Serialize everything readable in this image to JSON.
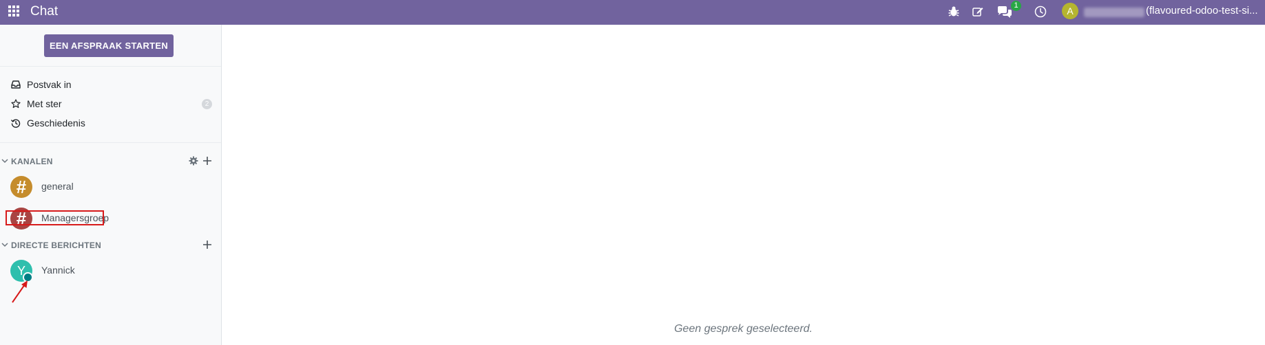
{
  "topbar": {
    "app_title": "Chat",
    "messages_badge": "1",
    "user_avatar_letter": "A",
    "company": "(flavoured-odoo-test-si...",
    "icons": [
      "apps-icon",
      "debug-bug-icon",
      "edit-icon",
      "chat-bubbles-icon",
      "clock-icon"
    ]
  },
  "sidebar": {
    "start_meeting": "EEN AFSPRAAK STARTEN",
    "mailboxes": [
      {
        "label": "Postvak in",
        "icon": "inbox-icon"
      },
      {
        "label": "Met ster",
        "icon": "star-icon",
        "counter": "2"
      },
      {
        "label": "Geschiedenis",
        "icon": "history-icon"
      }
    ],
    "channels_header": "KANALEN",
    "channels": [
      {
        "name": "general",
        "avatar": "#",
        "color": "#c58c2c"
      },
      {
        "name": "Managersgroep",
        "avatar": "#",
        "color": "#a94442"
      }
    ],
    "dm_header": "DIRECTE BERICHTEN",
    "direct_messages": [
      {
        "name": "Yannick",
        "avatar": "Y",
        "color": "#2ebfad",
        "status": "online"
      }
    ]
  },
  "main": {
    "empty_message": "Geen gesprek geselecteerd."
  },
  "colors": {
    "brand": "#71639e",
    "badge": "#28a745",
    "annotation": "#d71a1a"
  }
}
